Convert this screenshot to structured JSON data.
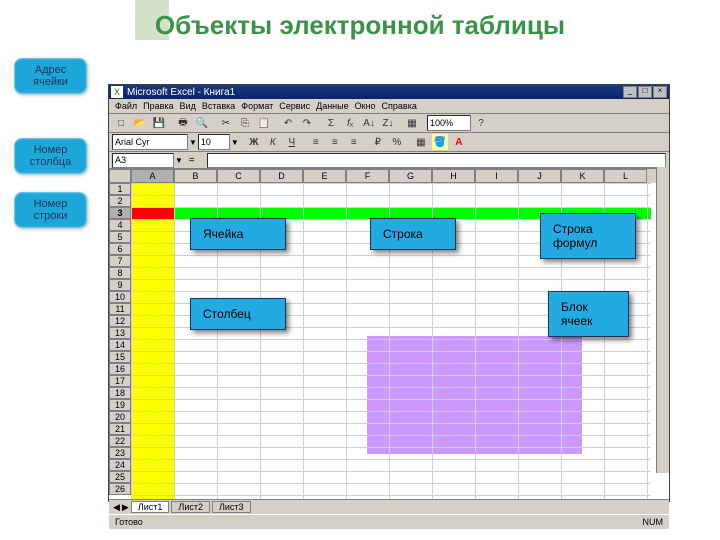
{
  "slide": {
    "title": "Объекты электронной таблицы"
  },
  "side_labels": {
    "address": "Адрес ячейки",
    "column": "Номер столбца",
    "row": "Номер строки"
  },
  "callouts": {
    "cell": "Ячейка",
    "row": "Строка",
    "formula_bar": "Строка формул",
    "column": "Столбец",
    "block": "Блок ячеек"
  },
  "excel": {
    "title": "Microsoft Excel - Книга1",
    "menu": [
      "Файл",
      "Правка",
      "Вид",
      "Вставка",
      "Формат",
      "Сервис",
      "Данные",
      "Окно",
      "Справка"
    ],
    "font_name": "Arial Cyr",
    "font_size": "10",
    "name_box": "A3",
    "zoom": "100%",
    "columns": [
      "A",
      "B",
      "C",
      "D",
      "E",
      "F",
      "G",
      "H",
      "I",
      "J",
      "K",
      "L"
    ],
    "rows_visible": 26,
    "active_row": 3,
    "sheet_tabs": [
      "Лист1",
      "Лист2",
      "Лист3"
    ],
    "status_ready": "Готово",
    "status_num": "NUM"
  }
}
